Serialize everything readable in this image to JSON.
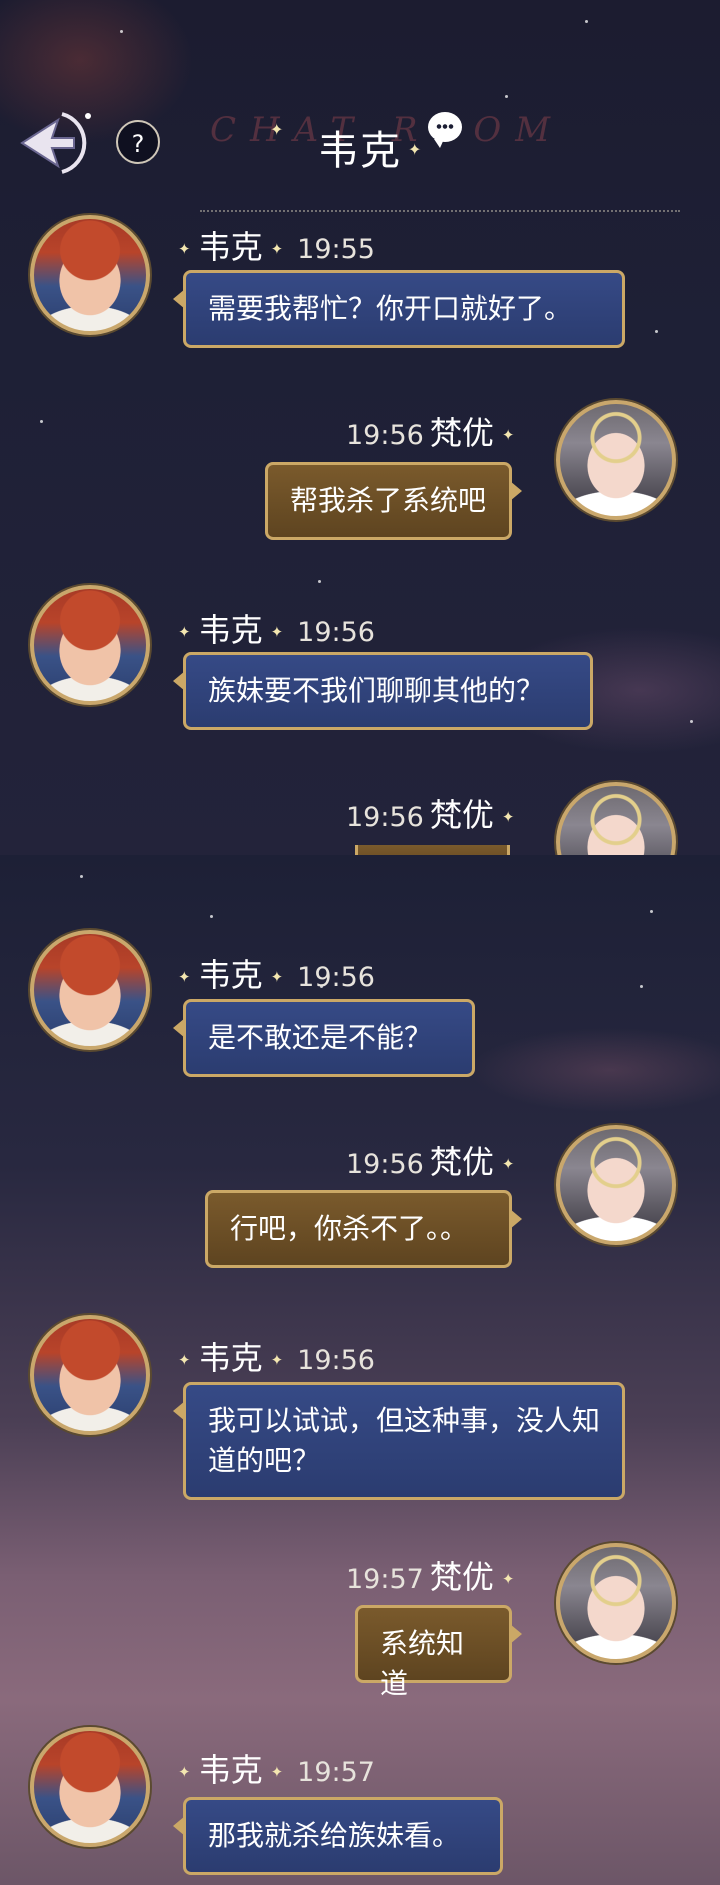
{
  "header": {
    "title": "韦克",
    "watermark": "CHAT ROOM",
    "help_label": "?"
  },
  "colors": {
    "accent_gold": "#cba866",
    "left_bubble": "#2f4278",
    "right_bubble": "#6b4e26"
  },
  "icons": {
    "back": "back-arrow-icon",
    "help": "question-mark-icon",
    "chat": "speech-bubble-icon"
  },
  "screen1": {
    "messages": [
      {
        "sender": "韦克",
        "time": "19:55",
        "text": "需要我帮忙？你开口就好了。"
      },
      {
        "sender": "梵优",
        "time": "19:56",
        "text": "帮我杀了系统吧"
      },
      {
        "sender": "韦克",
        "time": "19:56",
        "text": "族妹要不我们聊聊其他的？"
      },
      {
        "sender": "梵优",
        "time": "19:56"
      }
    ]
  },
  "screen2": {
    "messages": [
      {
        "sender": "韦克",
        "time": "19:56",
        "text": "是不敢还是不能？"
      },
      {
        "sender": "梵优",
        "time": "19:56",
        "text": "行吧，你杀不了。。"
      },
      {
        "sender": "韦克",
        "time": "19:56",
        "text": "我可以试试，但这种事，没人知道的吧？"
      },
      {
        "sender": "梵优",
        "time": "19:57",
        "text": "系统知道"
      },
      {
        "sender": "韦克",
        "time": "19:57",
        "text": "那我就杀给族妹看。"
      }
    ]
  }
}
